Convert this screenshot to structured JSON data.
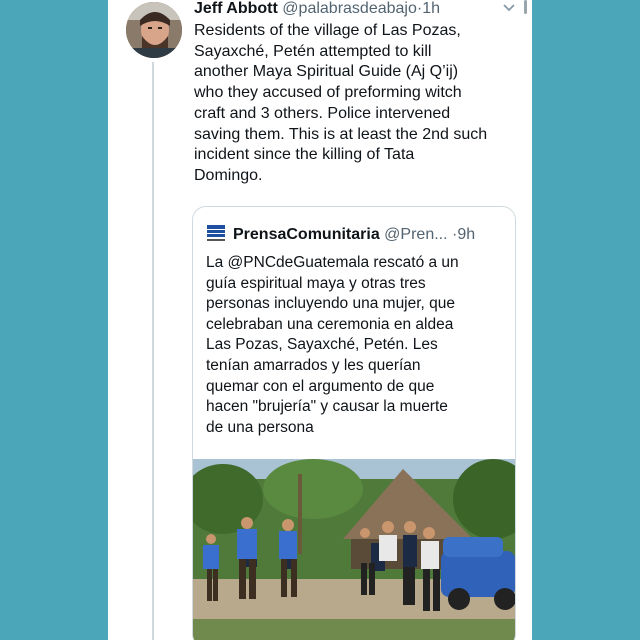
{
  "tweet": {
    "author_name": "Jeff Abbott",
    "author_handle": "@palabrasdeabajo",
    "separator": "·",
    "time": "1h",
    "body": "Residents of the village of Las Pozas,\nSayaxché, Petén attempted to kill\nanother Maya Spiritual Guide (Aj Q’ij)\nwho they accused of preforming witch\ncraft and 3 others. Police intervened\nsaving them. This is at least the 2nd such\nincident since the killing of Tata\nDomingo.",
    "menu_icon": "chevron-down-icon"
  },
  "quote": {
    "author_name": "PrensaComunitaria",
    "author_handle": "@Pren...",
    "separator": "·",
    "time": "9h",
    "avatar_icon": "prensa-comunitaria-logo",
    "body": "La @PNCdeGuatemala rescató  a un\nguía espiritual maya y otras tres\npersonas incluyendo una mujer, que\ncelebraban una ceremonia en aldea\nLas Pozas, Sayaxché, Petén. Les\ntenían amarrados y les querían\nquemar con el argumento de que\nhacen \"brujería\" y causar la muerte\nde una persona",
    "media_icon": "photo-of-police-and-villagers"
  },
  "colors": {
    "background": "#4aa6b8",
    "card": "#ffffff",
    "text": "#0f1419",
    "secondary_text": "#536471",
    "border": "#cfd9de"
  }
}
